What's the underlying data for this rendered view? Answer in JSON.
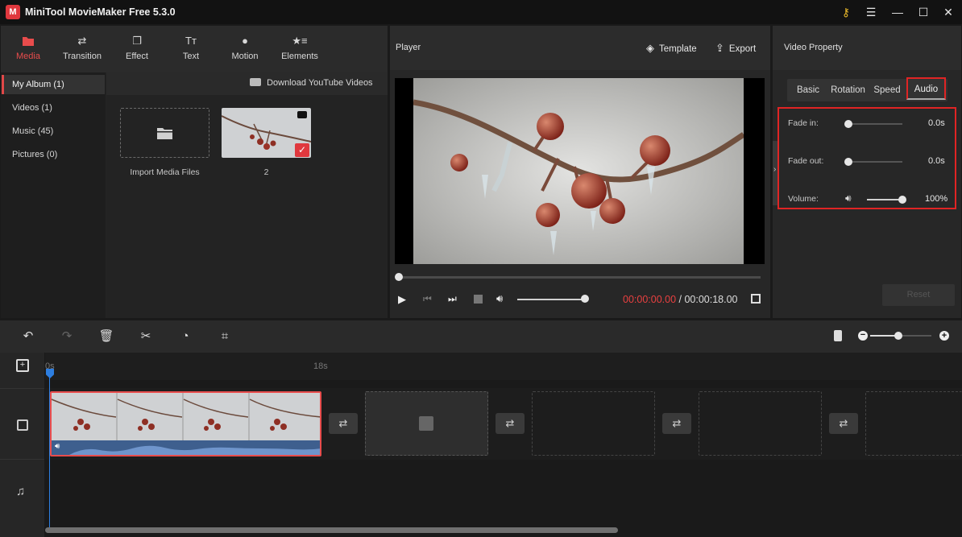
{
  "app": {
    "logo_letter": "M",
    "title": "MiniTool MovieMaker Free 5.3.0"
  },
  "window_controls": {
    "key": "⚷",
    "menu": "☰",
    "minimize": "—",
    "maximize": "☐",
    "close": "✕"
  },
  "media_tabs": [
    {
      "label": "Media",
      "icon": "folder-icon",
      "glyph": "▀"
    },
    {
      "label": "Transition",
      "icon": "transition-icon",
      "glyph": "⇄"
    },
    {
      "label": "Effect",
      "icon": "effect-icon",
      "glyph": "❐"
    },
    {
      "label": "Text",
      "icon": "text-icon",
      "glyph": "Tт"
    },
    {
      "label": "Motion",
      "icon": "motion-icon",
      "glyph": "●"
    },
    {
      "label": "Elements",
      "icon": "elements-icon",
      "glyph": "★≡"
    }
  ],
  "album": [
    {
      "label": "My Album (1)"
    },
    {
      "label": "Videos (1)"
    },
    {
      "label": "Music (45)"
    },
    {
      "label": "Pictures (0)"
    }
  ],
  "media": {
    "download_label": "Download YouTube Videos",
    "import_label": "Import Media Files",
    "clip_label": "2"
  },
  "player": {
    "title": "Player",
    "template_label": "Template",
    "export_label": "Export",
    "current_time": "00:00:00.00",
    "separator": " / ",
    "total_time": "00:00:18.00"
  },
  "property": {
    "title": "Video Property",
    "tabs": [
      "Basic",
      "Rotation",
      "Speed",
      "Audio"
    ],
    "fade_in_label": "Fade in:",
    "fade_in_value": "0.0s",
    "fade_out_label": "Fade out:",
    "fade_out_value": "0.0s",
    "volume_label": "Volume:",
    "volume_value": "100%",
    "reset_label": "Reset"
  },
  "timeline": {
    "ruler_start": "0s",
    "ruler_mark": "18s"
  },
  "colors": {
    "accent": "#e84c4c",
    "time_red": "#e84040",
    "highlight_box": "#e02424"
  }
}
